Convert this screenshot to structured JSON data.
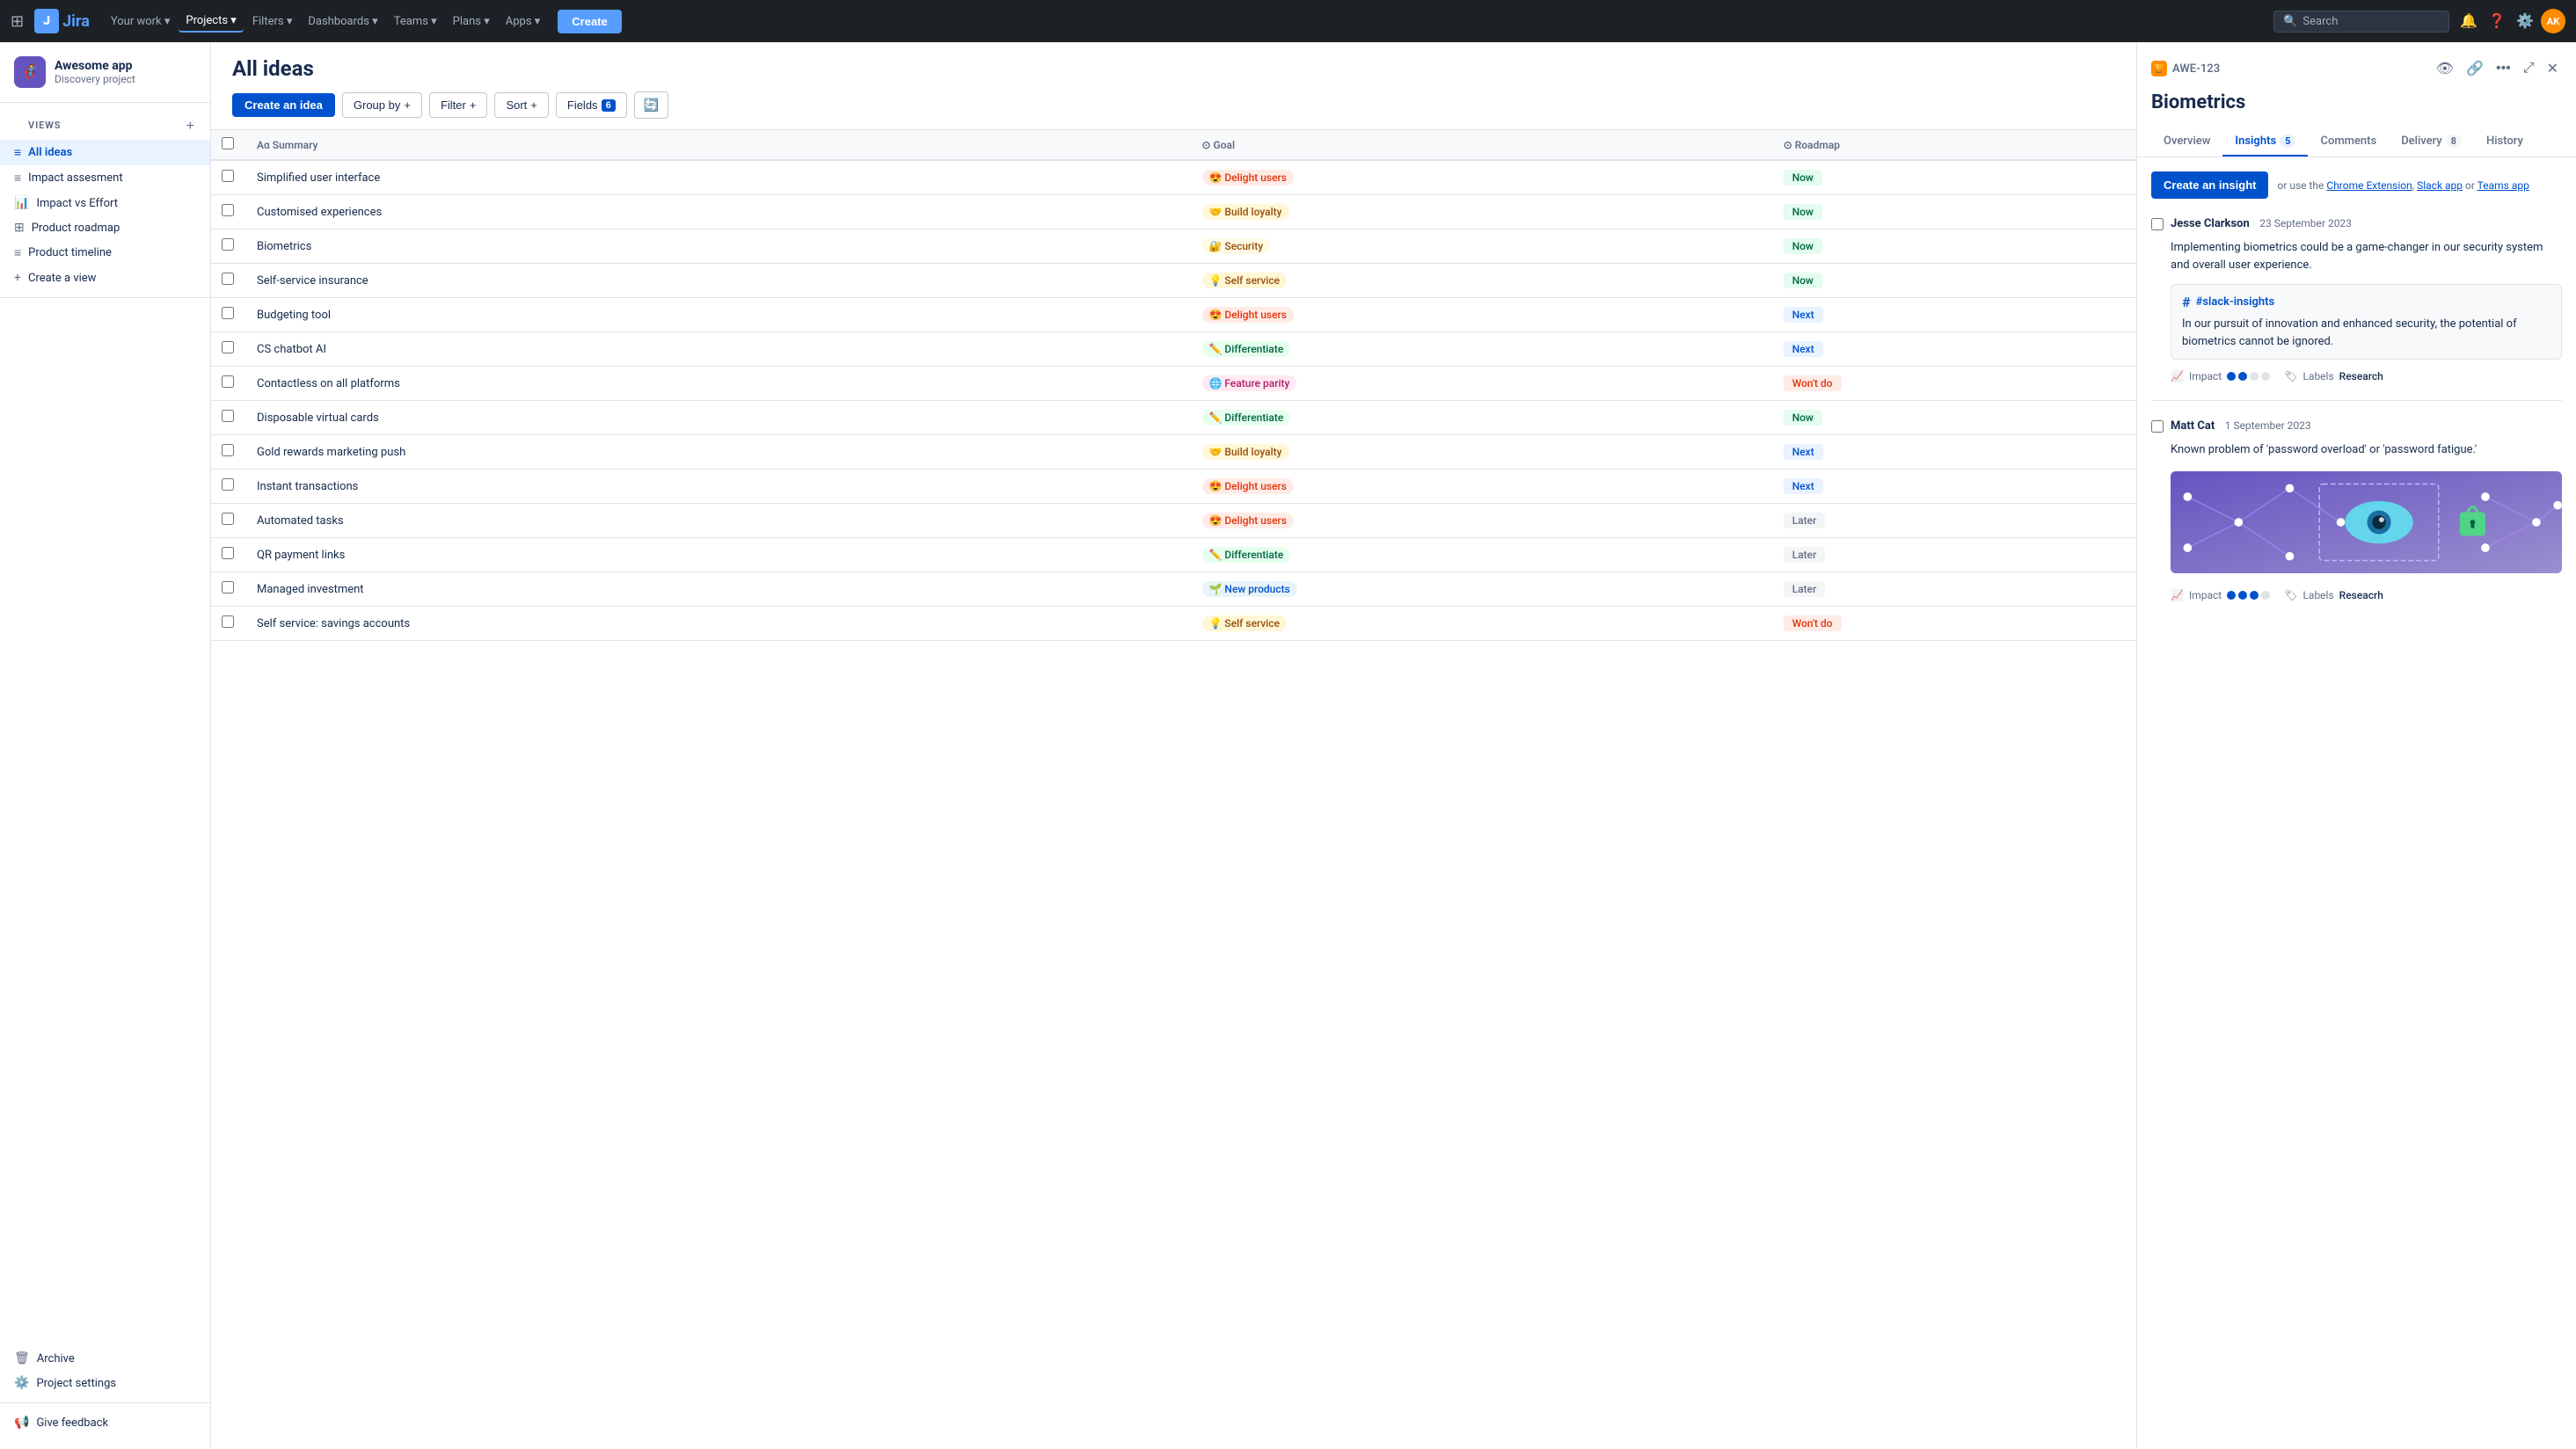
{
  "nav": {
    "logo_text": "Jira",
    "items": [
      {
        "label": "Your work",
        "has_chevron": true
      },
      {
        "label": "Projects",
        "has_chevron": true,
        "active": true
      },
      {
        "label": "Filters",
        "has_chevron": true
      },
      {
        "label": "Dashboards",
        "has_chevron": true
      },
      {
        "label": "Teams",
        "has_chevron": true
      },
      {
        "label": "Plans",
        "has_chevron": true
      },
      {
        "label": "Apps",
        "has_chevron": true
      }
    ],
    "create_label": "Create",
    "search_placeholder": "Search"
  },
  "sidebar": {
    "project_name": "Awesome app",
    "project_type": "Discovery project",
    "views_label": "VIEWS",
    "items": [
      {
        "label": "All ideas",
        "icon": "≡",
        "active": true
      },
      {
        "label": "Impact assesment",
        "icon": "≡"
      },
      {
        "label": "Impact vs Effort",
        "icon": "📊"
      },
      {
        "label": "Product roadmap",
        "icon": "⊞"
      },
      {
        "label": "Product timeline",
        "icon": "≡"
      },
      {
        "label": "Create a view",
        "icon": "+"
      }
    ],
    "archive_label": "Archive",
    "settings_label": "Project settings",
    "feedback_label": "Give feedback"
  },
  "page": {
    "title": "All ideas",
    "toolbar": {
      "create_idea": "Create an idea",
      "group_by": "Group by",
      "filter": "Filter",
      "sort": "Sort",
      "fields": "Fields",
      "fields_count": "6"
    },
    "table": {
      "columns": [
        "Summary",
        "Goal",
        "Roadmap"
      ],
      "rows": [
        {
          "summary": "Simplified user interface",
          "goal": "Delight users",
          "goal_class": "goal-delight",
          "goal_emoji": "😍",
          "roadmap": "Now",
          "roadmap_class": "roadmap-now"
        },
        {
          "summary": "Customised experiences",
          "goal": "Build loyalty",
          "goal_class": "goal-loyalty",
          "goal_emoji": "🤝",
          "roadmap": "Now",
          "roadmap_class": "roadmap-now"
        },
        {
          "summary": "Biometrics",
          "goal": "Security",
          "goal_class": "goal-security",
          "goal_emoji": "🔐",
          "roadmap": "Now",
          "roadmap_class": "roadmap-now"
        },
        {
          "summary": "Self-service insurance",
          "goal": "Self service",
          "goal_class": "goal-selfservice",
          "goal_emoji": "💡",
          "roadmap": "Now",
          "roadmap_class": "roadmap-now"
        },
        {
          "summary": "Budgeting tool",
          "goal": "Delight users",
          "goal_class": "goal-delight",
          "goal_emoji": "😍",
          "roadmap": "Next",
          "roadmap_class": "roadmap-next"
        },
        {
          "summary": "CS chatbot AI",
          "goal": "Differentiate",
          "goal_class": "goal-differentiate",
          "goal_emoji": "✏️",
          "roadmap": "Next",
          "roadmap_class": "roadmap-next"
        },
        {
          "summary": "Contactless on all platforms",
          "goal": "Feature parity",
          "goal_class": "goal-feature",
          "goal_emoji": "🌐",
          "roadmap": "Won't do",
          "roadmap_class": "roadmap-wont"
        },
        {
          "summary": "Disposable virtual cards",
          "goal": "Differentiate",
          "goal_class": "goal-differentiate",
          "goal_emoji": "✏️",
          "roadmap": "Now",
          "roadmap_class": "roadmap-now"
        },
        {
          "summary": "Gold rewards marketing push",
          "goal": "Build loyalty",
          "goal_class": "goal-loyalty",
          "goal_emoji": "🤝",
          "roadmap": "Next",
          "roadmap_class": "roadmap-next"
        },
        {
          "summary": "Instant transactions",
          "goal": "Delight users",
          "goal_class": "goal-delight",
          "goal_emoji": "😍",
          "roadmap": "Next",
          "roadmap_class": "roadmap-next"
        },
        {
          "summary": "Automated tasks",
          "goal": "Delight users",
          "goal_class": "goal-delight",
          "goal_emoji": "😍",
          "roadmap": "Later",
          "roadmap_class": "roadmap-later"
        },
        {
          "summary": "QR payment links",
          "goal": "Differentiate",
          "goal_class": "goal-differentiate",
          "goal_emoji": "✏️",
          "roadmap": "Later",
          "roadmap_class": "roadmap-later"
        },
        {
          "summary": "Managed investment",
          "goal": "New products",
          "goal_class": "goal-new",
          "goal_emoji": "🌱",
          "roadmap": "Later",
          "roadmap_class": "roadmap-later"
        },
        {
          "summary": "Self service: savings accounts",
          "goal": "Self service",
          "goal_class": "goal-selfservice",
          "goal_emoji": "💡",
          "roadmap": "Won't do",
          "roadmap_class": "roadmap-wont"
        }
      ]
    }
  },
  "detail": {
    "id": "AWE-123",
    "title": "Biometrics",
    "tabs": [
      {
        "label": "Overview",
        "active": false
      },
      {
        "label": "Insights",
        "count": "5",
        "active": true
      },
      {
        "label": "Comments",
        "active": false
      },
      {
        "label": "Delivery",
        "count": "8",
        "active": false
      },
      {
        "label": "History",
        "active": false
      }
    ],
    "create_insight_label": "Create an insight",
    "create_insight_text": "or use the",
    "chrome_ext": "Chrome Extension",
    "slack_app": "Slack app",
    "teams_app": "Teams app",
    "insights": [
      {
        "author": "Jesse Clarkson",
        "date": "23 September 2023",
        "body": "Implementing biometrics could be a game-changer in our security system and overall user experience.",
        "slack_channel": "#slack-insights",
        "slack_body": "In our pursuit of innovation and enhanced security, the potential of biometrics cannot be ignored.",
        "impact_dots": 2,
        "impact_total": 4,
        "labels_label": "Labels",
        "label_value": "Research",
        "has_image": false
      },
      {
        "author": "Matt Cat",
        "date": "1 September 2023",
        "body": "Known problem of 'password overload' or 'password fatigue.'",
        "impact_dots": 3,
        "impact_total": 4,
        "labels_label": "Labels",
        "label_value": "Reseacrh",
        "has_image": true
      }
    ]
  }
}
